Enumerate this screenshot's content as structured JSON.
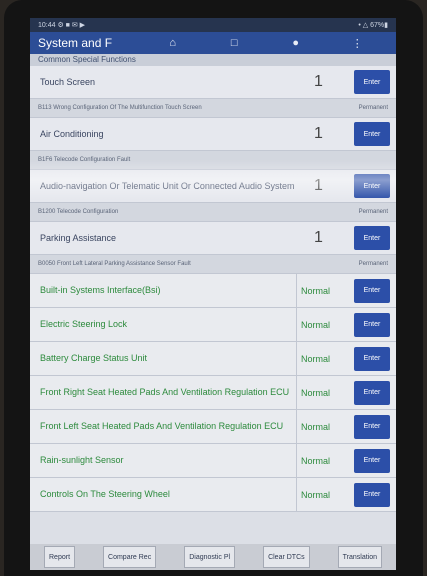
{
  "statusbar": {
    "left": "10:44 ⚙ ■ ✉ ▶",
    "right": "• △ 67%▮"
  },
  "titlebar": {
    "title": "System and F",
    "icons": [
      "home-icon",
      "document-icon",
      "user-icon",
      "menu-icon"
    ]
  },
  "section": {
    "label": "Common Special Functions"
  },
  "fault_rows": [
    {
      "name": "Touch Screen",
      "count": "1",
      "button": "Enter",
      "sub_code": "B113 Wrong Configuration Of The Multifunction Touch Screen",
      "sub_status": "Permanent"
    },
    {
      "name": "Air Conditioning",
      "count": "1",
      "button": "Enter",
      "sub_code": "B1F6 Telecode Configuration Fault",
      "sub_status": ""
    },
    {
      "name": "Audio-navigation Or Telematic Unit Or Connected Audio System",
      "count": "1",
      "button": "Enter",
      "sub_code": "B1200 Telecode Configuration",
      "sub_status": "Permanent"
    },
    {
      "name": "Parking Assistance",
      "count": "1",
      "button": "Enter",
      "sub_code": "B0050 Front Left Lateral Parking Assistance Sensor Fault",
      "sub_status": "Permanent"
    }
  ],
  "ok_rows": [
    {
      "name": "Built-in Systems Interface(Bsi)",
      "status": "Normal",
      "button": "Enter"
    },
    {
      "name": "Electric Steering Lock",
      "status": "Normal",
      "button": "Enter"
    },
    {
      "name": "Battery Charge Status Unit",
      "status": "Normal",
      "button": "Enter"
    },
    {
      "name": "Front Right Seat Heated Pads And Ventilation Regulation ECU",
      "status": "Normal",
      "button": "Enter"
    },
    {
      "name": "Front Left Seat Heated Pads And Ventilation Regulation ECU",
      "status": "Normal",
      "button": "Enter"
    },
    {
      "name": "Rain-sunlight Sensor",
      "status": "Normal",
      "button": "Enter"
    },
    {
      "name": "Controls On The Steering Wheel",
      "status": "Normal",
      "button": "Enter"
    }
  ],
  "bottombar": [
    "Report",
    "Compare Rec",
    "Diagnostic Pl",
    "Clear DTCs",
    "Translation"
  ]
}
